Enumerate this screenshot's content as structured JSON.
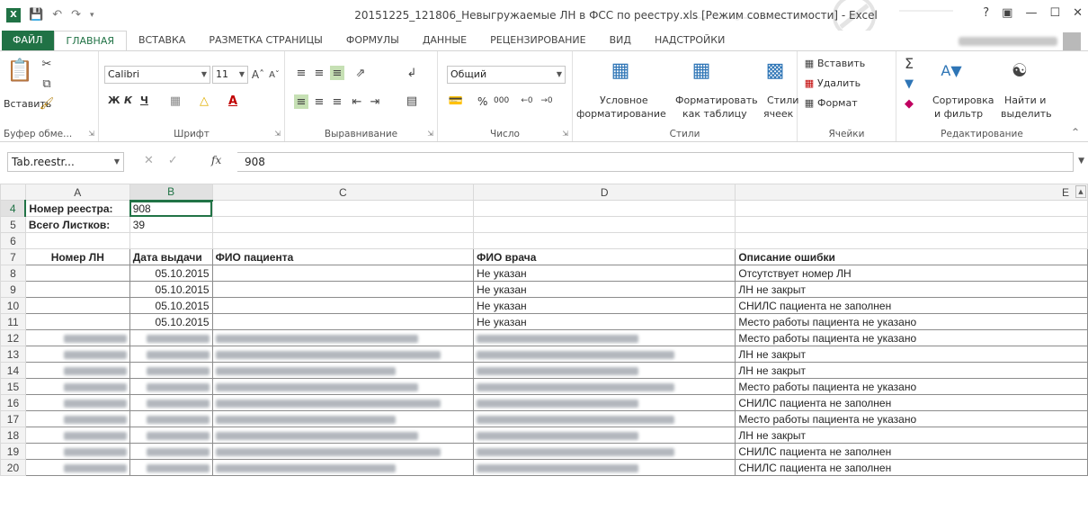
{
  "window": {
    "title": "20151225_121806_Невыгружаемые ЛН в ФСС по реестру.xls  [Режим совместимости] - Excel",
    "help": "?",
    "logo": "X"
  },
  "tabs": [
    "ФАЙЛ",
    "ГЛАВНАЯ",
    "ВСТАВКА",
    "РАЗМЕТКА СТРАНИЦЫ",
    "ФОРМУЛЫ",
    "ДАННЫЕ",
    "РЕЦЕНЗИРОВАНИЕ",
    "ВИД",
    "НАДСТРОЙКИ"
  ],
  "ribbon": {
    "clipboard": {
      "paste": "Вставить",
      "label": "Буфер обме..."
    },
    "font": {
      "name": "Calibri",
      "size": "11",
      "bold": "Ж",
      "italic": "К",
      "underline": "Ч",
      "label": "Шрифт"
    },
    "alignment": {
      "label": "Выравнивание"
    },
    "number": {
      "format": "Общий",
      "percent": "%",
      "thousands": "000",
      "label": "Число"
    },
    "styles": {
      "conditional1": "Условное",
      "conditional2": "форматирование",
      "table1": "Форматировать",
      "table2": "как таблицу",
      "cell1": "Стили",
      "cell2": "ячеек",
      "label": "Стили"
    },
    "cells": {
      "insert": "Вставить",
      "delete": "Удалить",
      "format": "Формат",
      "label": "Ячейки"
    },
    "editing": {
      "sort1": "Сортировка",
      "sort2": "и фильтр",
      "find1": "Найти и",
      "find2": "выделить",
      "label": "Редактирование"
    }
  },
  "formula_bar": {
    "name_box": "Tab.reestr...",
    "fx": "fx",
    "value": "908"
  },
  "columns": [
    "A",
    "B",
    "C",
    "D",
    "E"
  ],
  "rows": {
    "r4": {
      "num": "4",
      "a": "Номер реестра:",
      "b": "908"
    },
    "r5": {
      "num": "5",
      "a": "Всего Листков:",
      "b": "39"
    },
    "r6": {
      "num": "6"
    },
    "r7": {
      "num": "7",
      "a": "Номер ЛН",
      "b": "Дата выдачи",
      "c": "ФИО пациента",
      "d": "ФИО врача",
      "e": "Описание ошибки"
    },
    "data": [
      {
        "num": "8",
        "date": "05.10.2015",
        "doctor": "Не указан",
        "error": "Отсутствует номер ЛН"
      },
      {
        "num": "9",
        "date": "05.10.2015",
        "doctor": "Не указан",
        "error": "ЛН не закрыт"
      },
      {
        "num": "10",
        "date": "05.10.2015",
        "doctor": "Не указан",
        "error": "СНИЛС пациента не заполнен"
      },
      {
        "num": "11",
        "date": "05.10.2015",
        "doctor": "Не указан",
        "error": "Место работы пациента не указано"
      },
      {
        "num": "12",
        "error": "Место работы пациента не указано"
      },
      {
        "num": "13",
        "error": "ЛН не закрыт"
      },
      {
        "num": "14",
        "error": "ЛН не закрыт"
      },
      {
        "num": "15",
        "error": "Место работы пациента не указано"
      },
      {
        "num": "16",
        "error": "СНИЛС пациента не заполнен"
      },
      {
        "num": "17",
        "error": "Место работы пациента не указано"
      },
      {
        "num": "18",
        "error": "ЛН не закрыт"
      },
      {
        "num": "19",
        "error": "СНИЛС пациента не заполнен"
      },
      {
        "num": "20",
        "error": "СНИЛС пациента не заполнен"
      }
    ]
  }
}
